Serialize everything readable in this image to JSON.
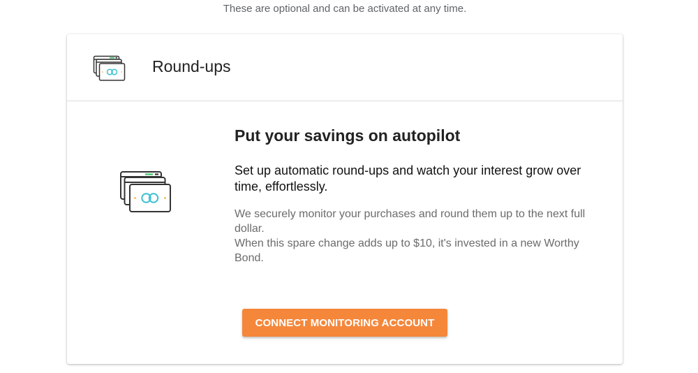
{
  "intro": {
    "subtitle": "These are optional and can be activated at any time."
  },
  "card": {
    "header": {
      "icon": "cards-icon",
      "title": "Round-ups"
    },
    "body": {
      "icon": "cards-icon",
      "headline": "Put your savings on autopilot",
      "lead": "Set up automatic round-ups and watch your interest grow over time, effortlessly.",
      "detail_line1": "We securely monitor your purchases and round them up to the next full dollar.",
      "detail_line2": "When this spare change adds up to $10, it's invested in a new Worthy Bond."
    },
    "cta_label": "CONNECT MONITORING ACCOUNT"
  },
  "colors": {
    "accent": "#f5873b",
    "icon_green": "#3ec26b",
    "icon_teal": "#3fc1d3",
    "icon_yellow": "#f5b93b",
    "icon_dark": "#333333"
  }
}
